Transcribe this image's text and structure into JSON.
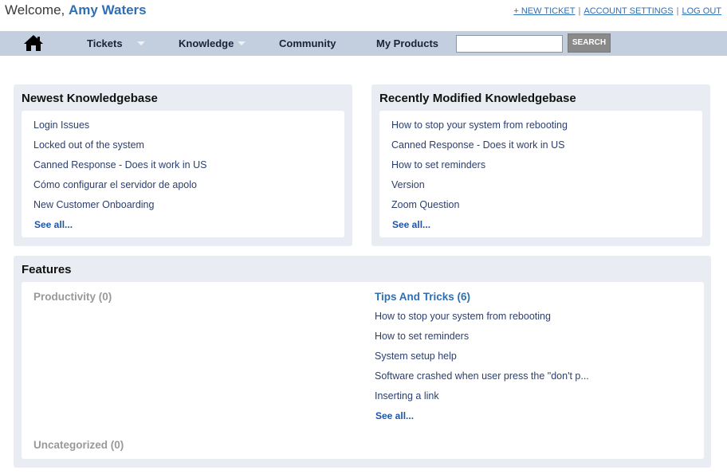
{
  "header": {
    "welcome_prefix": "Welcome,",
    "user_name": "Amy Waters",
    "links": {
      "new_ticket": "+ NEW TICKET",
      "separator": "|",
      "account_settings": "ACCOUNT SETTINGS",
      "log_out": "LOG OUT"
    }
  },
  "nav": {
    "home_icon": "home-icon",
    "items": {
      "tickets": "Tickets",
      "knowledge": "Knowledge",
      "community": "Community",
      "my_products": "My Products"
    },
    "search": {
      "value": "",
      "placeholder": "",
      "button": "SEARCH"
    }
  },
  "newest": {
    "title": "Newest Knowledgebase",
    "items": [
      "Login Issues",
      "Locked out of the system",
      "Canned Response - Does it work in US",
      "Cómo configurar el servidor de apolo",
      "New Customer Onboarding"
    ],
    "see_all": "See all..."
  },
  "recent": {
    "title": "Recently Modified Knowledgebase",
    "items": [
      "How to stop your system from rebooting",
      "Canned Response - Does it work in US",
      "How to set reminders",
      "Version",
      "Zoom Question"
    ],
    "see_all": "See all..."
  },
  "features": {
    "title": "Features",
    "productivity": "Productivity (0)",
    "tips": {
      "title": "Tips And Tricks (6)",
      "items": [
        "How to stop your system from rebooting",
        "How to set reminders",
        "System setup help",
        "Software crashed when user press the \"don't p...",
        "Inserting a link"
      ],
      "see_all": "See all..."
    },
    "uncategorized": "Uncategorized (0)"
  },
  "colors": {
    "accent": "#2f6fb3",
    "navbar": "#c3cfdf",
    "panel": "#e9edf3"
  }
}
